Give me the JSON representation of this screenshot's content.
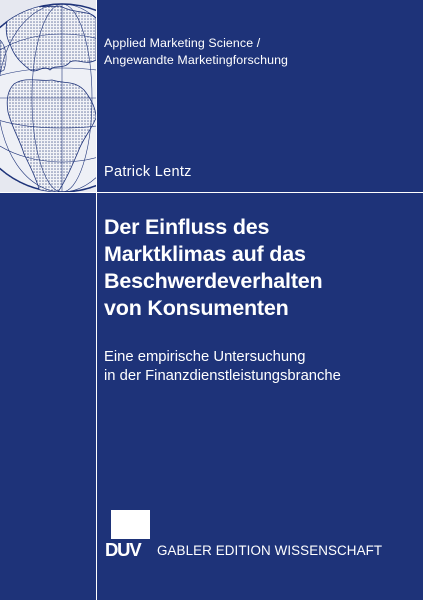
{
  "series": {
    "line1": "Applied Marketing Science /",
    "line2": "Angewandte Marketingforschung"
  },
  "author": "Patrick Lentz",
  "title": {
    "line1": "Der Einfluss des",
    "line2": "Marktklimas auf das",
    "line3": "Beschwerdeverhalten",
    "line4": "von Konsumenten"
  },
  "subtitle": {
    "line1": "Eine empirische Untersuchung",
    "line2": "in der Finanzdienstleistungsbranche"
  },
  "publisher": {
    "logo_text": "DUV",
    "name": "GABLER EDITION WISSENSCHAFT"
  },
  "colors": {
    "cover": "#1e3379",
    "text": "#ffffff"
  },
  "icons": {
    "globe": "globe-icon",
    "logo": "duv-logo-icon"
  }
}
